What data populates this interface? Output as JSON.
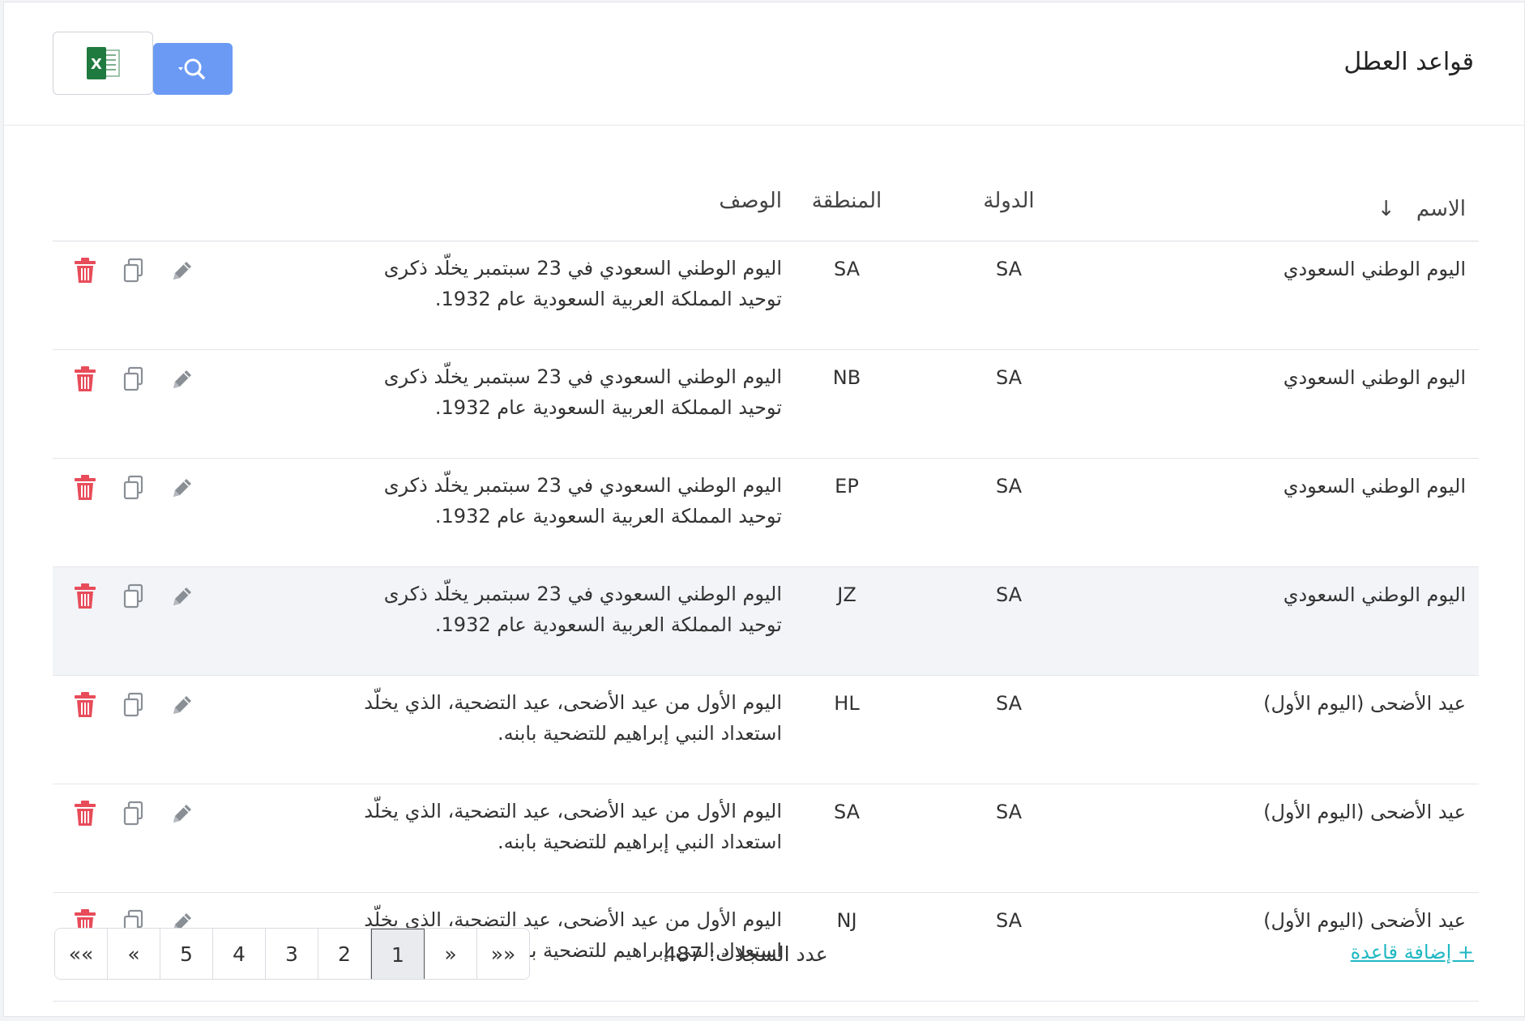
{
  "header": {
    "title": "قواعد العطل",
    "excel_icon": "excel-icon",
    "search_icon": "search-dropdown-icon"
  },
  "table": {
    "columns": {
      "name": "الاسم",
      "sort_indicator": "↓",
      "country": "الدولة",
      "region": "المنطقة",
      "description": "الوصف"
    },
    "rows": [
      {
        "name": "اليوم الوطني السعودي",
        "country": "SA",
        "region": "SA",
        "desc_line1": "اليوم الوطني السعودي في 23 سبتمبر يخلّد ذكرى",
        "desc_line2": "توحيد المملكة العربية السعودية عام 1932."
      },
      {
        "name": "اليوم الوطني السعودي",
        "country": "SA",
        "region": "NB",
        "desc_line1": "اليوم الوطني السعودي في 23 سبتمبر يخلّد ذكرى",
        "desc_line2": "توحيد المملكة العربية السعودية عام 1932."
      },
      {
        "name": "اليوم الوطني السعودي",
        "country": "SA",
        "region": "EP",
        "desc_line1": "اليوم الوطني السعودي في 23 سبتمبر يخلّد ذكرى",
        "desc_line2": "توحيد المملكة العربية السعودية عام 1932."
      },
      {
        "name": "اليوم الوطني السعودي",
        "country": "SA",
        "region": "JZ",
        "desc_line1": "اليوم الوطني السعودي في 23 سبتمبر يخلّد ذكرى",
        "desc_line2": "توحيد المملكة العربية السعودية عام 1932."
      },
      {
        "name": "عيد الأضحى (اليوم الأول)",
        "country": "SA",
        "region": "HL",
        "desc_line1": "اليوم الأول من عيد الأضحى، عيد التضحية، الذي يخلّد",
        "desc_line2": "استعداد النبي إبراهيم للتضحية بابنه."
      },
      {
        "name": "عيد الأضحى (اليوم الأول)",
        "country": "SA",
        "region": "SA",
        "desc_line1": "اليوم الأول من عيد الأضحى، عيد التضحية، الذي يخلّد",
        "desc_line2": "استعداد النبي إبراهيم للتضحية بابنه."
      },
      {
        "name": "عيد الأضحى (اليوم الأول)",
        "country": "SA",
        "region": "NJ",
        "desc_line1": "اليوم الأول من عيد الأضحى، عيد التضحية، الذي يخلّد",
        "desc_line2": "استعداد النبي إبراهيم للتضحية بابنه."
      }
    ],
    "row_actions": [
      "pencil-icon",
      "copy-icon",
      "trash-icon"
    ]
  },
  "footer": {
    "add_rule": "+ إضافة قاعدة",
    "record_count": "عدد السجلات: 487",
    "pagination": {
      "first": "««",
      "prev": "«",
      "pages": [
        "5",
        "4",
        "3",
        "2",
        "1"
      ],
      "next": "»",
      "last": "»»",
      "current": "1"
    }
  },
  "colors": {
    "primary": "#6b9af5",
    "danger": "#e84c5a",
    "link": "#1fb7c2",
    "excel_green": "#1f7a3f"
  }
}
